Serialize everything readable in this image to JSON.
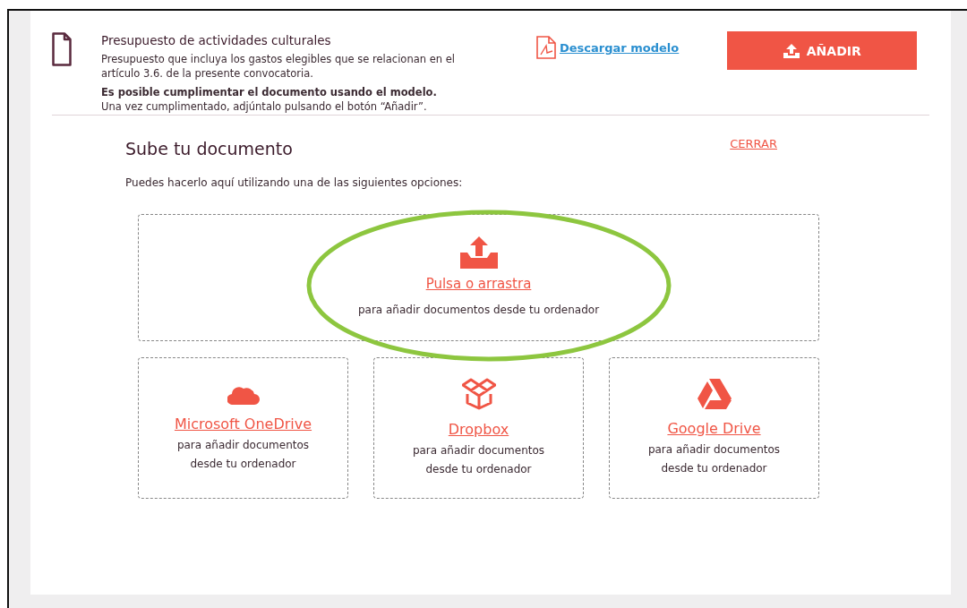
{
  "document": {
    "title": "Presupuesto de actividades culturales",
    "description": "Presupuesto que incluya los gastos elegibles que se relacionan en el artículo 3.6. de la presente convocatoria.",
    "note_emphasis": "Es posible cumplimentar el documento usando el modelo.",
    "note": "Una vez cumplimentado, adjúntalo pulsando el botón “Añadir”.",
    "download_link": "Descargar modelo",
    "add_button": "AÑADIR"
  },
  "upload": {
    "title": "Sube tu documento",
    "close_link": "CERRAR",
    "instructions": "Puedes hacerlo aquí utilizando una de las siguientes opciones:",
    "options": [
      {
        "kind": "local",
        "label": "Pulsa o arrastra",
        "description": "para añadir documentos desde tu ordenador",
        "highlighted": true
      },
      {
        "kind": "onedrive",
        "label": "Microsoft OneDrive",
        "description": "para añadir documentos desde tu ordenador",
        "highlighted": false
      },
      {
        "kind": "dropbox",
        "label": "Dropbox",
        "description": "para añadir documentos desde tu ordenador",
        "highlighted": false
      },
      {
        "kind": "gdrive",
        "label": "Google Drive",
        "description": "para añadir documentos desde tu ordenador",
        "highlighted": false
      }
    ]
  }
}
